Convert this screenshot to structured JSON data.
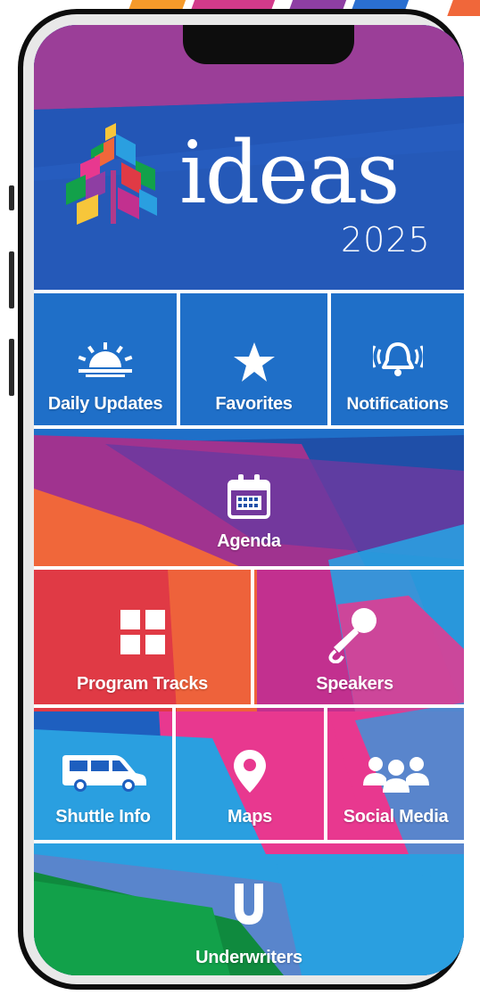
{
  "app": {
    "name": "ideas",
    "year": "2025"
  },
  "menu": {
    "daily_updates": "Daily Updates",
    "favorites": "Favorites",
    "notifications": "Notifications",
    "agenda": "Agenda",
    "program_tracks": "Program Tracks",
    "speakers": "Speakers",
    "shuttle_info": "Shuttle Info",
    "maps": "Maps",
    "social_media": "Social Media",
    "underwriters": "Underwriters"
  },
  "icons": {
    "daily_updates": "sunrise-icon",
    "favorites": "star-icon",
    "notifications": "bell-ringing-icon",
    "agenda": "calendar-icon",
    "program_tracks": "grid-icon",
    "speakers": "microphone-icon",
    "shuttle_info": "van-icon",
    "maps": "map-pin-icon",
    "social_media": "users-group-icon",
    "underwriters": "u-icon"
  },
  "colors": {
    "background_blue": "#1f4fa8",
    "magenta": "#c2308f",
    "pink": "#e8388f",
    "red": "#e03a45",
    "orange": "#f0673a",
    "green": "#12a14a",
    "cyan": "#2a9fe0",
    "purple": "#8e3ea3",
    "text": "#ffffff"
  }
}
